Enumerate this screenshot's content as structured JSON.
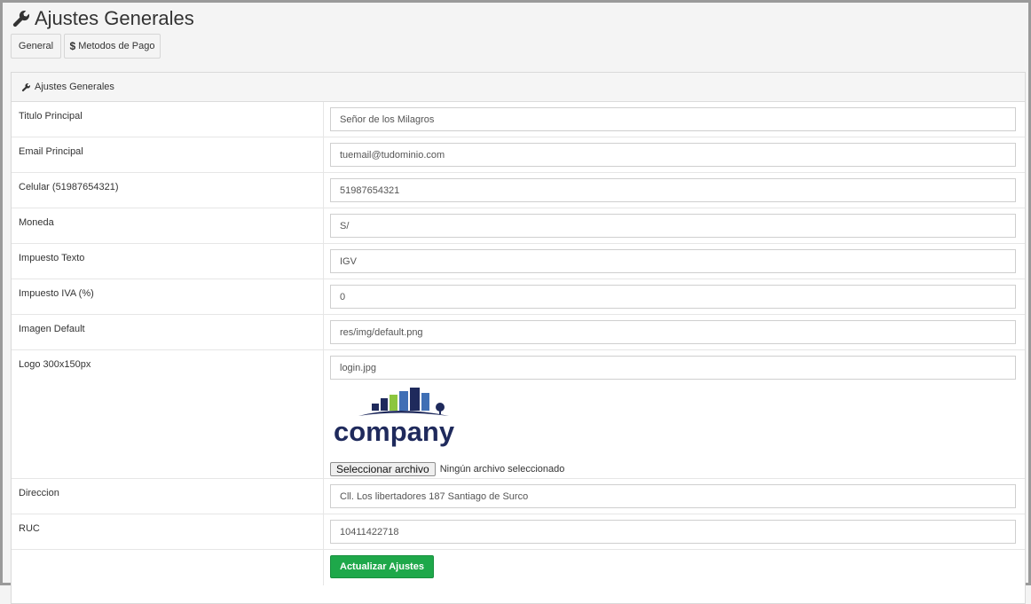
{
  "page": {
    "title": "Ajustes Generales",
    "title_icon": "wrench-icon"
  },
  "tabs": [
    {
      "label": "General"
    },
    {
      "label": "Metodos de Pago",
      "icon_glyph": "$"
    }
  ],
  "panel": {
    "heading": "Ajustes Generales",
    "heading_icon": "wrench-icon"
  },
  "fields": [
    {
      "label": "Titulo Principal",
      "value": "Señor de los Milagros"
    },
    {
      "label": "Email Principal",
      "value": "tuemail@tudominio.com"
    },
    {
      "label": "Celular (51987654321)",
      "value": "51987654321"
    },
    {
      "label": "Moneda",
      "value": "S/"
    },
    {
      "label": "Impuesto Texto",
      "value": "IGV"
    },
    {
      "label": "Impuesto IVA (%)",
      "value": "0"
    },
    {
      "label": "Imagen Default",
      "value": "res/img/default.png"
    }
  ],
  "logo": {
    "label": "Logo 300x150px",
    "value": "login.jpg",
    "logo_text": "company",
    "file_button": "Seleccionar archivo",
    "file_status": "Ningún archivo seleccionado"
  },
  "fields_after": [
    {
      "label": "Direccion",
      "value": "Cll. Los libertadores 187 Santiago de Surco"
    },
    {
      "label": "RUC",
      "value": "10411422718"
    }
  ],
  "submit": {
    "label": "Actualizar Ajustes"
  },
  "colors": {
    "accent_green": "#1ea84a",
    "logo_navy": "#1f2a5c",
    "logo_green": "#8cc63f",
    "logo_blue": "#3f6fb5"
  }
}
